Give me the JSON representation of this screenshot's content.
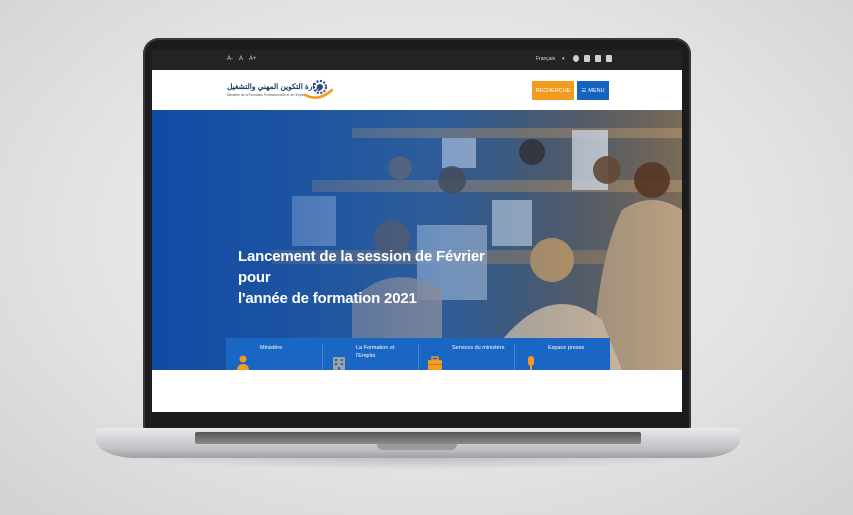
{
  "topbar": {
    "font_sizes": [
      "A-",
      "A",
      "A+"
    ],
    "language": "Français",
    "language_caret": "▾",
    "social_icons": [
      "facebook-icon",
      "twitter-icon",
      "linkedin-icon",
      "rss-icon"
    ]
  },
  "header": {
    "logo_arabic": "وزارة التكوين المهني والتشغيل",
    "logo_french": "Ministère de la Formation Professionnelle et de l'Emploi",
    "search_label": "RECHERCHE",
    "menu_label": "MENU",
    "menu_icon": "☰"
  },
  "hero": {
    "title_line1": "Lancement de la session de Février pour",
    "title_line2": "l'année de formation 2021"
  },
  "cards": [
    {
      "label": "Ministère",
      "icon": "person-icon"
    },
    {
      "label": "La Formation et l'Emploi",
      "icon": "building-icon"
    },
    {
      "label": "Services du ministère",
      "icon": "briefcase-icon"
    },
    {
      "label": "Espace presse",
      "icon": "microphone-icon"
    }
  ],
  "colors": {
    "accent_orange": "#f29c1f",
    "primary_blue": "#1565c0",
    "card_blue": "#1a66c4",
    "topbar": "#232323"
  }
}
